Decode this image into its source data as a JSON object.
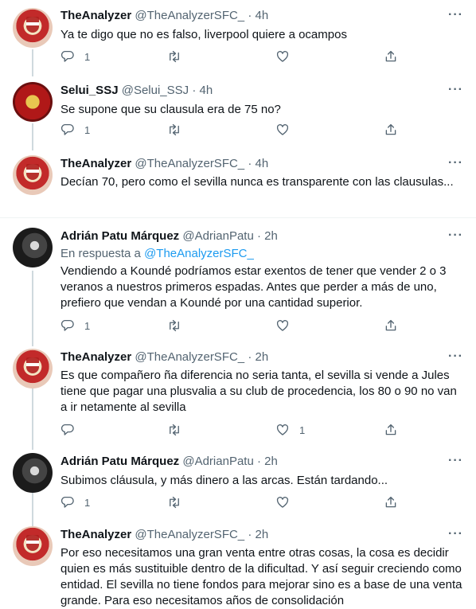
{
  "tweets": [
    {
      "name": "TheAnalyzer",
      "handle": "@TheAnalyzerSFC_",
      "time": "4h",
      "text": "Ya te digo que no es falso, liverpool quiere a ocampos",
      "reply_count": "1",
      "retweet_count": "",
      "like_count": ""
    },
    {
      "name": "Selui_SSJ",
      "handle": "@Selui_SSJ",
      "time": "4h",
      "text": "Se supone que su clausula era de 75 no?",
      "reply_count": "1",
      "retweet_count": "",
      "like_count": ""
    },
    {
      "name": "TheAnalyzer",
      "handle": "@TheAnalyzerSFC_",
      "time": "4h",
      "text": "Decían 70, pero como el sevilla nunca es transparente con las clausulas...",
      "reply_count": "1",
      "retweet_count": "",
      "like_count": ""
    },
    {
      "name": "Adrián Patu Márquez",
      "handle": "@AdrianPatu",
      "time": "2h",
      "reply_prefix": "En respuesta a",
      "reply_handle": "@TheAnalyzerSFC_",
      "text": "Vendiendo a Koundé podríamos estar exentos de tener que vender 2 o 3 veranos a nuestros primeros espadas. Antes que perder a más de uno, prefiero que vendan a Koundé por una cantidad superior.",
      "reply_count": "1",
      "retweet_count": "",
      "like_count": ""
    },
    {
      "name": "TheAnalyzer",
      "handle": "@TheAnalyzerSFC_",
      "time": "2h",
      "text": "Es que compañero ña diferencia no seria tanta, el sevilla si vende a Jules tiene que pagar una plusvalia a su club de procedencia, los 80 o 90 no van a ir netamente al sevilla",
      "reply_count": "",
      "retweet_count": "",
      "like_count": "1"
    },
    {
      "name": "Adrián Patu Márquez",
      "handle": "@AdrianPatu",
      "time": "2h",
      "text": "Subimos cláusula, y más dinero a las arcas. Están tardando...",
      "reply_count": "1",
      "retweet_count": "",
      "like_count": ""
    },
    {
      "name": "TheAnalyzer",
      "handle": "@TheAnalyzerSFC_",
      "time": "2h",
      "text": "Por eso necesitamos una gran venta entre otras cosas, la cosa es decidir quien es más sustituible dentro de la dificultad. Y así seguir creciendo como entidad. El sevilla no tiene fondos para mejorar sino es a base de una venta grande. Para eso necesitamos años de consolidación"
    }
  ],
  "separator": "·",
  "more_label": "···",
  "icons": {
    "reply": "reply-icon",
    "retweet": "retweet-icon",
    "like": "heart-icon",
    "share": "share-icon",
    "more": "more-icon"
  },
  "colors": {
    "link": "#1d9bf0",
    "secondary_text": "#536471",
    "thread_line": "#cfd9de"
  }
}
